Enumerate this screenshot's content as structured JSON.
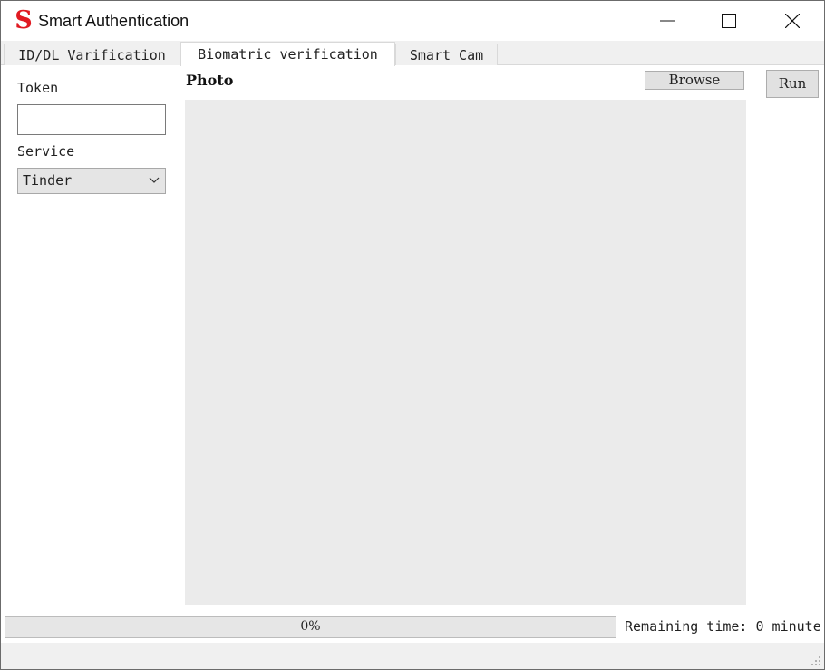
{
  "window": {
    "title": "Smart Authentication",
    "logo_letter": "S",
    "logo_color": "#e01a22",
    "controls": [
      "minimize-icon",
      "maximize-icon",
      "close-icon"
    ]
  },
  "tabs": [
    {
      "label": "ID/DL Varification",
      "active": false
    },
    {
      "label": "Biomatric verification",
      "active": true
    },
    {
      "label": "Smart Cam",
      "active": false
    }
  ],
  "form": {
    "token_label": "Token",
    "token_value": "",
    "service_label": "Service",
    "service_selected": "Tinder"
  },
  "photo": {
    "label": "Photo",
    "browse_label": "Browse"
  },
  "run_label": "Run",
  "progress": {
    "value": 0,
    "text": "0%",
    "fill_color": "#06b025"
  },
  "remaining_text": "Remaining time: 0 minute"
}
